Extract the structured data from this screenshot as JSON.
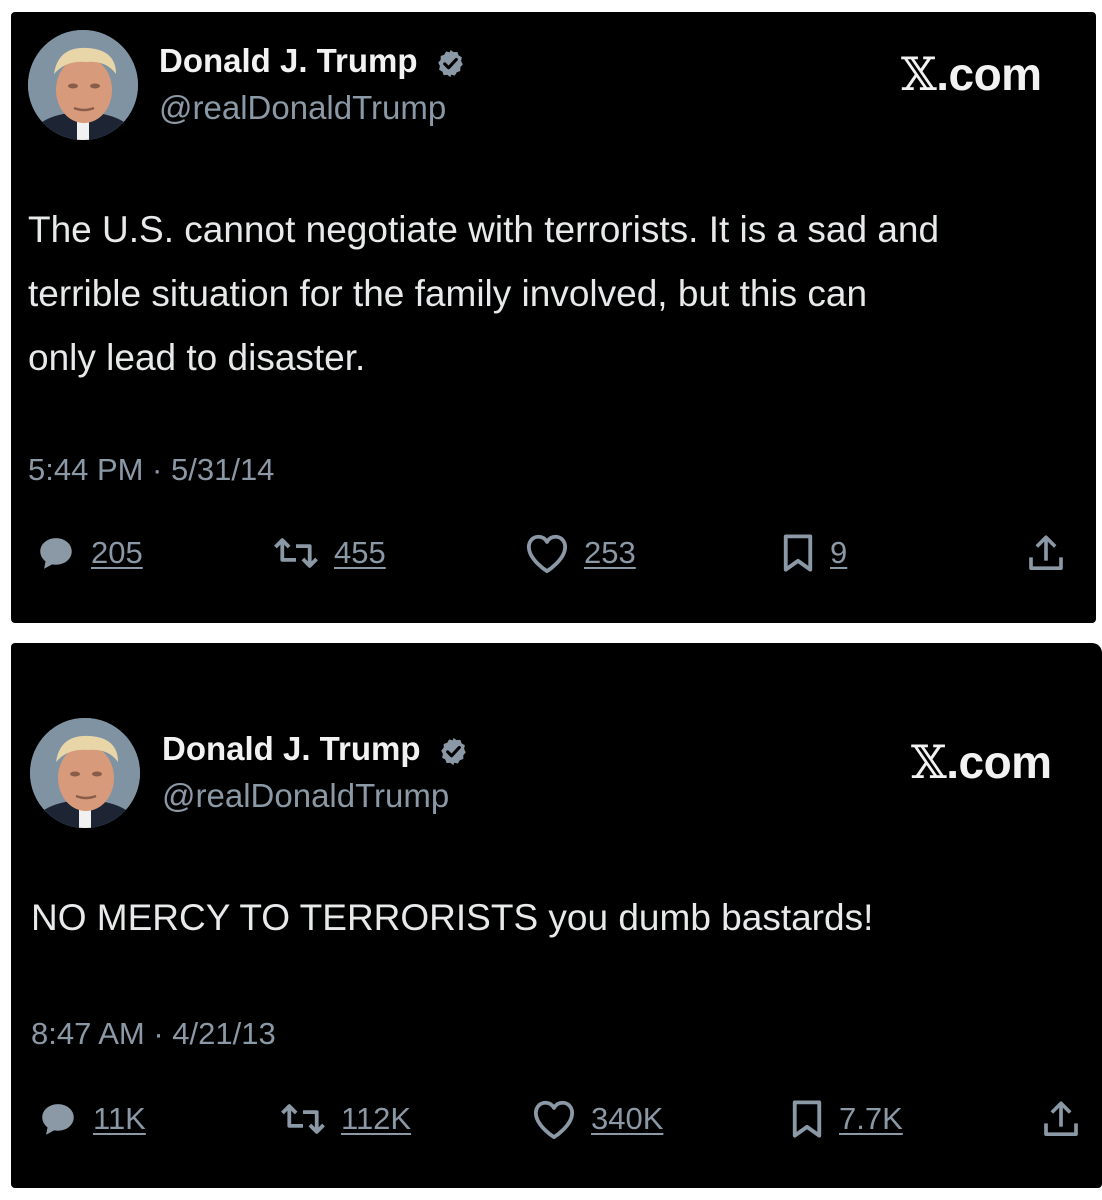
{
  "colors": {
    "background": "#000000",
    "text": "#e7e9ea",
    "secondary": "#8b98a5",
    "verified": "#8b98a5"
  },
  "tweets": [
    {
      "author_name": "Donald J. Trump",
      "author_handle": "@realDonaldTrump",
      "brand_x": "𝕏",
      "brand_domain": ".com",
      "text_lines": [
        "The U.S. cannot negotiate with terrorists. It is a sad and",
        "terrible situation for the family involved, but this can",
        "only lead to disaster."
      ],
      "timestamp": "5:44 PM · 5/31/14",
      "replies": "205",
      "retweets": "455",
      "likes": "253",
      "bookmarks": "9",
      "icons": [
        "reply-icon",
        "retweet-icon",
        "like-icon",
        "bookmark-icon",
        "share-icon"
      ]
    },
    {
      "author_name": "Donald J. Trump",
      "author_handle": "@realDonaldTrump",
      "brand_x": "𝕏",
      "brand_domain": ".com",
      "text_lines": [
        "NO MERCY TO TERRORISTS you dumb bastards!"
      ],
      "timestamp": "8:47 AM · 4/21/13",
      "replies": "11K",
      "retweets": "112K",
      "likes": "340K",
      "bookmarks": "7.7K",
      "icons": [
        "reply-icon",
        "retweet-icon",
        "like-icon",
        "bookmark-icon",
        "share-icon"
      ]
    }
  ]
}
